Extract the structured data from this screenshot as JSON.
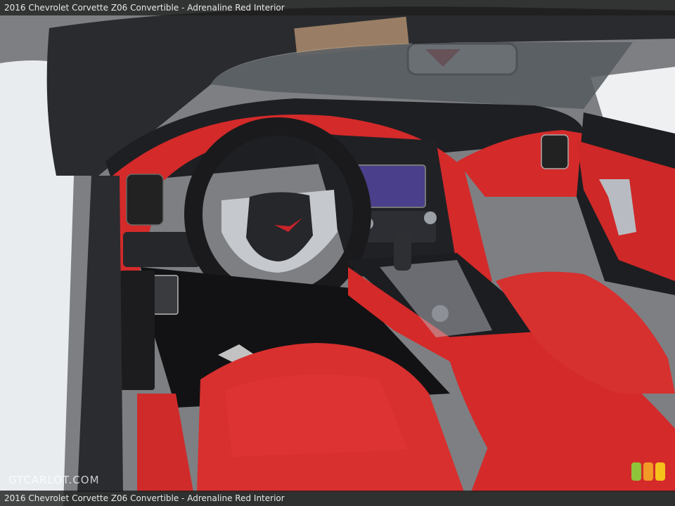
{
  "title": "2016 Chevrolet Corvette Z06 Convertible - Adrenaline Red Interior",
  "caption": "2016 Chevrolet Corvette Z06 Convertible - Adrenaline Red Interior",
  "watermark": "GTCARLOT.COM",
  "colors": {
    "leather_red": "#d42a2a",
    "dash_black": "#1e1f22",
    "body_white": "#e9ecef",
    "trim_silver": "#b8bcc2",
    "screen": "#4a3f8a",
    "badge_green": "#8fc43a",
    "badge_orange": "#f29a26",
    "badge_yellow": "#f5c21b"
  }
}
